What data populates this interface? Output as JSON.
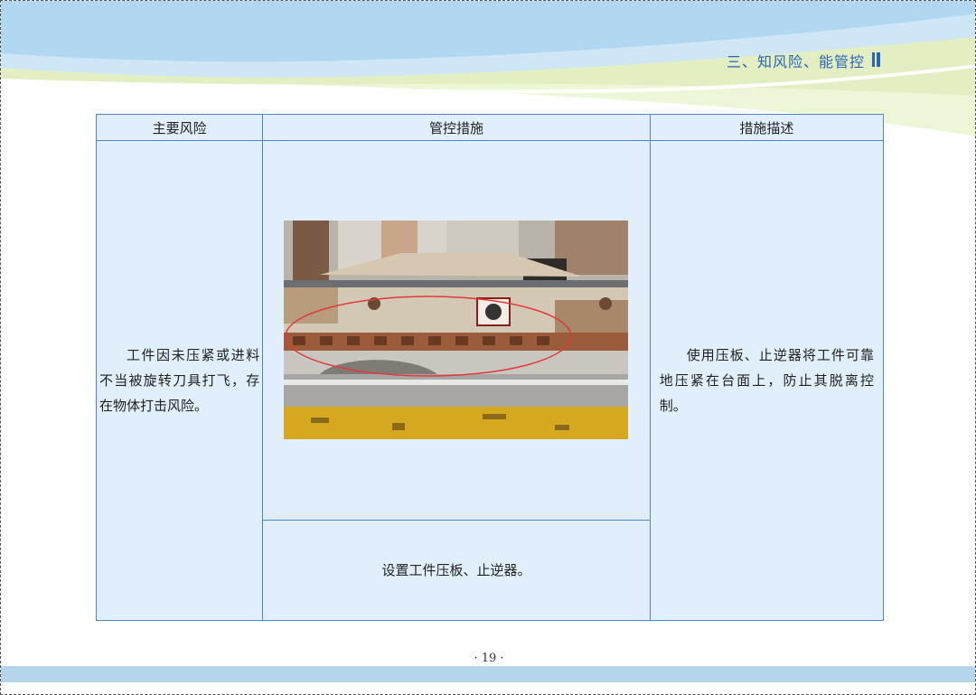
{
  "header": {
    "section_title": "三、知风险、能管控"
  },
  "table": {
    "headers": [
      "主要风险",
      "管控措施",
      "措施描述"
    ],
    "risk_text": "工件因未压紧或进料不当被旋转刀具打飞，存在物体打击风险。",
    "measure_text": "设置工件压板、止逆器。",
    "description_text": "使用压板、止逆器将工件可靠地压紧在台面上，防止其脱离控制。"
  },
  "footer": {
    "page_number": "· 19 ·"
  },
  "colors": {
    "accent_blue": "#2a64b5",
    "table_fill": "#e0effb",
    "table_border": "#4f86c9",
    "band_blue": "#b5d5ec",
    "band_green": "#e3efc2"
  }
}
